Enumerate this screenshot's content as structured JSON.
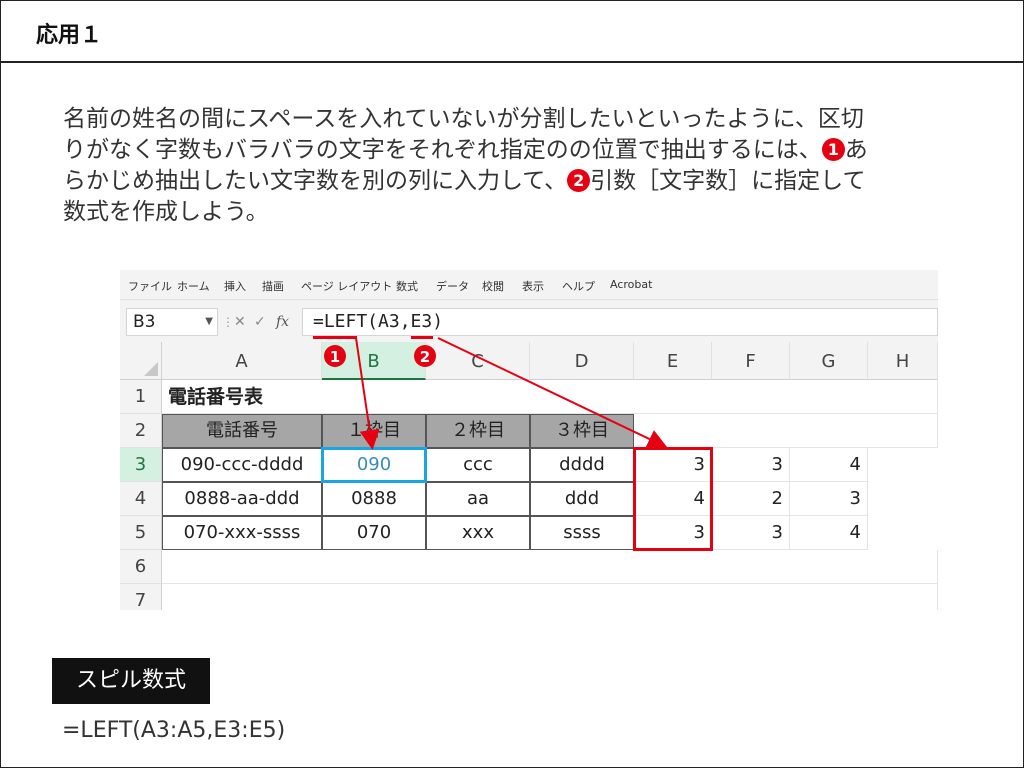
{
  "slide": {
    "title": "応用１",
    "description": [
      "名前の姓名の間にスペースを入れていないが分割したいといったように、区切",
      "りがなく字数もバラバラの文字をそれぞれ指定のの位置で抽出するには、",
      "あ",
      "らかじめ抽出したい文字数を別の列に入力して、",
      "引数［文字数］に指定して",
      "数式を作成しよう。"
    ],
    "markers": [
      "1",
      "2"
    ]
  },
  "excel": {
    "ribbon_tabs": [
      "ファイル",
      "ホーム",
      "挿入",
      "描画",
      "ページ レイアウト",
      "数式",
      "データ",
      "校閲",
      "表示",
      "ヘルプ",
      "Acrobat"
    ],
    "name_box": "B3",
    "formula": "=LEFT(A3,E3)",
    "fx_cancel": "✕",
    "fx_enter": "✓",
    "fx_label": "fx",
    "columns": [
      "A",
      "B",
      "C",
      "D",
      "E",
      "F",
      "G",
      "H"
    ],
    "rows": [
      "1",
      "2",
      "3",
      "4",
      "5",
      "6",
      "7"
    ],
    "title_cell": "電話番号表",
    "headers": [
      "電話番号",
      "１枠目",
      "２枠目",
      "３枠目"
    ],
    "data": [
      {
        "a": "090-ccc-dddd",
        "b": "090",
        "c": "ccc",
        "d": "dddd",
        "e": "3",
        "f": "3",
        "g": "4"
      },
      {
        "a": "0888-aa-ddd",
        "b": "0888",
        "c": "aa",
        "d": "ddd",
        "e": "4",
        "f": "2",
        "g": "3"
      },
      {
        "a": "070-xxx-ssss",
        "b": "070",
        "c": "xxx",
        "d": "ssss",
        "e": "3",
        "f": "3",
        "g": "4"
      }
    ],
    "colors": {
      "marker_red": "#e50012",
      "selection_blue": "#1aa6e0",
      "header_gray": "#a6a6a6"
    }
  },
  "spill": {
    "label": "スピル数式",
    "formula": "=LEFT(A3:A5,E3:E5)"
  }
}
